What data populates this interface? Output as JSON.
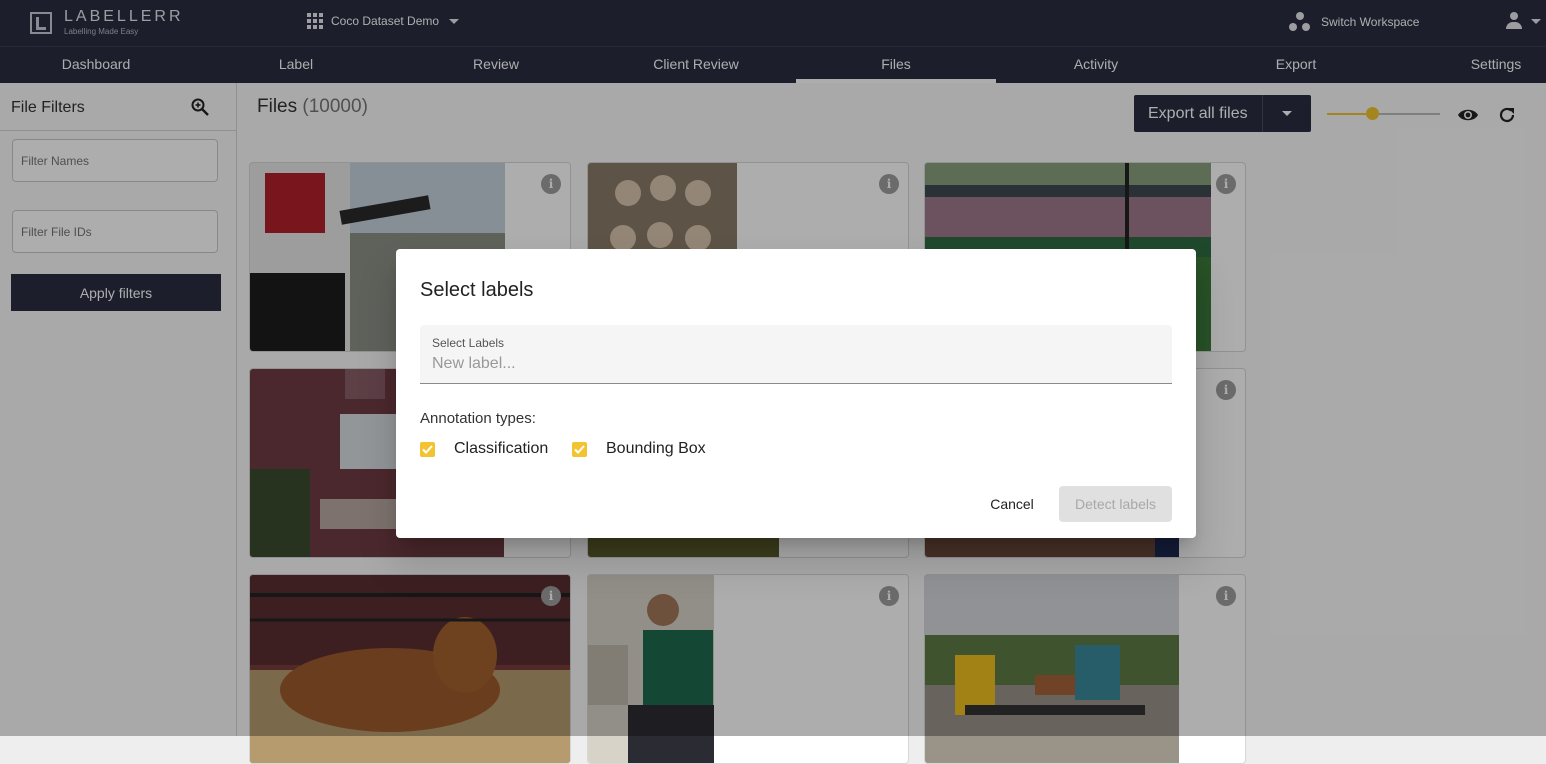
{
  "app": {
    "logo_name": "LABELLERR",
    "logo_tagline": "Labelling Made Easy",
    "project_name": "Coco Dataset Demo",
    "switch_workspace": "Switch Workspace"
  },
  "nav": {
    "items": [
      "Dashboard",
      "Label",
      "Review",
      "Client Review",
      "Files",
      "Activity",
      "Export",
      "Settings"
    ],
    "active": "Files"
  },
  "sidebar": {
    "title": "File Filters",
    "filter_names_placeholder": "Filter Names",
    "filter_ids_placeholder": "Filter File IDs",
    "apply_label": "Apply filters"
  },
  "files": {
    "title": "Files",
    "count": "(10000)",
    "export_label": "Export all files",
    "thumb_size_level": 0.4
  },
  "dialog": {
    "title": "Select labels",
    "field_label": "Select Labels",
    "field_placeholder": "New label...",
    "annotation_label": "Annotation types:",
    "types": [
      {
        "label": "Classification",
        "checked": true
      },
      {
        "label": "Bounding Box",
        "checked": true
      }
    ],
    "cancel": "Cancel",
    "detect": "Detect labels"
  },
  "colors": {
    "nav_bg": "#2b2d42",
    "accent": "#f4c430"
  },
  "icons": {
    "info": "i"
  }
}
